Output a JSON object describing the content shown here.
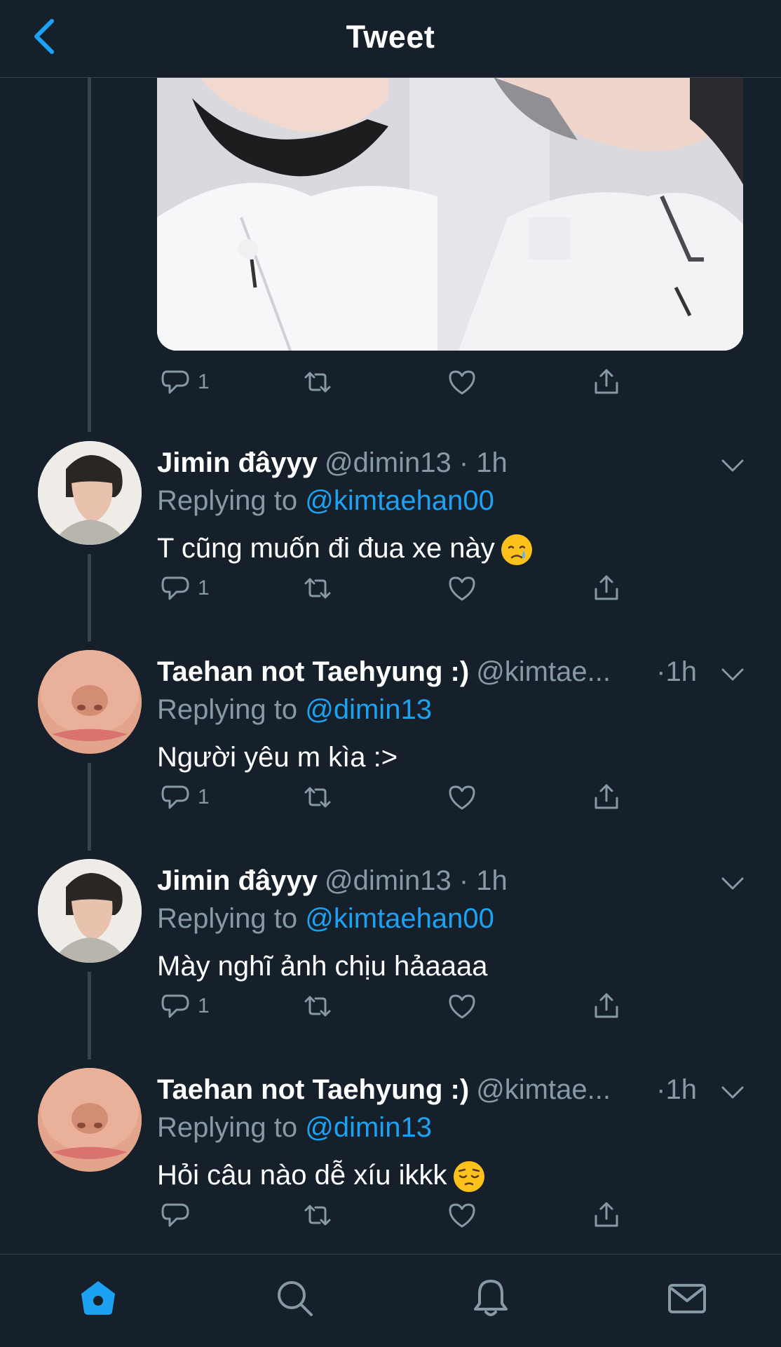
{
  "header": {
    "title": "Tweet",
    "back_icon": "chevron-left-icon"
  },
  "colors": {
    "background": "#15202b",
    "accent": "#1da1f2",
    "muted": "#8899a6",
    "divider": "#38444d"
  },
  "media": {
    "description_icon": "photo"
  },
  "first_actions": {
    "reply_count": "1"
  },
  "tweets": [
    {
      "name": "Jimin đâyyy",
      "handle": "@dimin13",
      "dot": "·",
      "time": "1h",
      "replying_label": "Replying to",
      "replying_to": "@kimtaehan00",
      "text": "T cũng muốn đi đua xe này",
      "emoji": "crying-face",
      "reply_count": "1"
    },
    {
      "name": "Taehan not Taehyung :)",
      "handle": "@kimtae...",
      "dot": "·",
      "time": "1h",
      "replying_label": "Replying to",
      "replying_to": "@dimin13",
      "text": "Người yêu m kìa :>",
      "reply_count": "1"
    },
    {
      "name": "Jimin đâyyy",
      "handle": "@dimin13",
      "dot": "·",
      "time": "1h",
      "replying_label": "Replying to",
      "replying_to": "@kimtaehan00",
      "text": "Mày nghĩ ảnh chịu hảaaaa",
      "reply_count": "1"
    },
    {
      "name": "Taehan not Taehyung :)",
      "handle": "@kimtae...",
      "dot": "·",
      "time": "1h",
      "replying_label": "Replying to",
      "replying_to": "@dimin13",
      "text": "Hỏi câu nào dễ xíu ikkk",
      "emoji": "pensive-face",
      "reply_count": ""
    }
  ],
  "bottom_nav": [
    "home",
    "search",
    "notifications",
    "messages"
  ]
}
